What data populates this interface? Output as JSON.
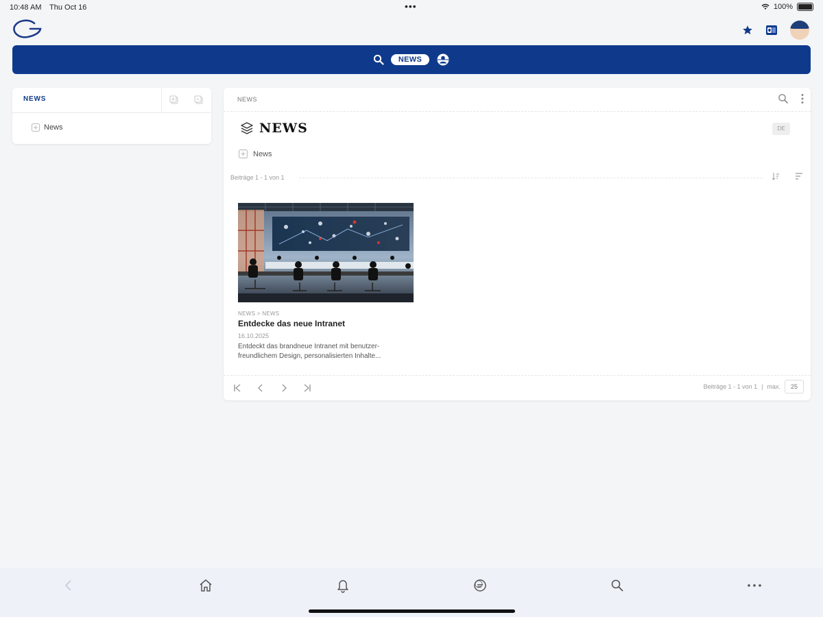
{
  "status_bar": {
    "time": "10:48 AM",
    "date": "Thu Oct 16",
    "battery": "100%"
  },
  "header": {
    "logo_icon": "g-logo-icon",
    "icons": [
      "star-icon",
      "outlook-icon",
      "avatar"
    ]
  },
  "search_bar": {
    "pill_label": "NEWS",
    "icons": [
      "search-icon",
      "globe-user-icon"
    ],
    "color": "#0f3a8c"
  },
  "left_panel": {
    "title": "NEWS",
    "tree_items": [
      {
        "label": "News",
        "icon": "tree-node-icon"
      }
    ]
  },
  "main_panel": {
    "breadcrumb": "NEWS",
    "title": "NEWS",
    "language_badge": "DE",
    "sub_item": "News",
    "count_top": "Beiträge 1 - 1 von 1",
    "articles": [
      {
        "category": "NEWS > NEWS",
        "title": "Entdecke das neue Intranet",
        "date": "16.10.2025",
        "teaser": "Entdeckt das brandneue Intranet mit benutzer-freundlichem Design, personalisierten Inhalte..."
      }
    ],
    "footer": {
      "count": "Beiträge 1 - 1 von 1",
      "max_label": "max.",
      "page_size": "25"
    }
  },
  "bottom_nav": {
    "items": [
      "back-icon",
      "home-icon",
      "bell-icon",
      "chat-icon",
      "search-icon",
      "more-icon"
    ]
  },
  "colors": {
    "accent": "#0f3a8c",
    "background": "#f4f5f7",
    "nav_background": "#eef2f8"
  }
}
